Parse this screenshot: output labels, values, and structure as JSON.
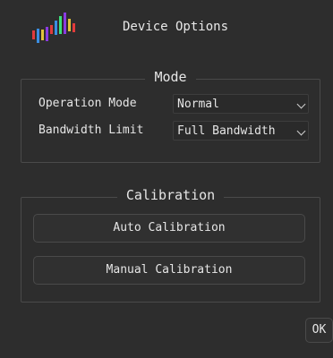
{
  "header": {
    "title": "Device Options",
    "logo_icon": "audio-spectrum-bars-icon"
  },
  "mode": {
    "title": "Mode",
    "operation_mode": {
      "label": "Operation Mode",
      "value": "Normal"
    },
    "bandwidth_limit": {
      "label": "Bandwidth Limit",
      "value": "Full Bandwidth"
    }
  },
  "calibration": {
    "title": "Calibration",
    "auto_label": "Auto Calibration",
    "manual_label": "Manual Calibration"
  },
  "footer": {
    "ok_label": "OK"
  },
  "colors": {
    "background": "#2d2d2d",
    "text": "#e6e6e6",
    "border": "#4a4a4a"
  }
}
